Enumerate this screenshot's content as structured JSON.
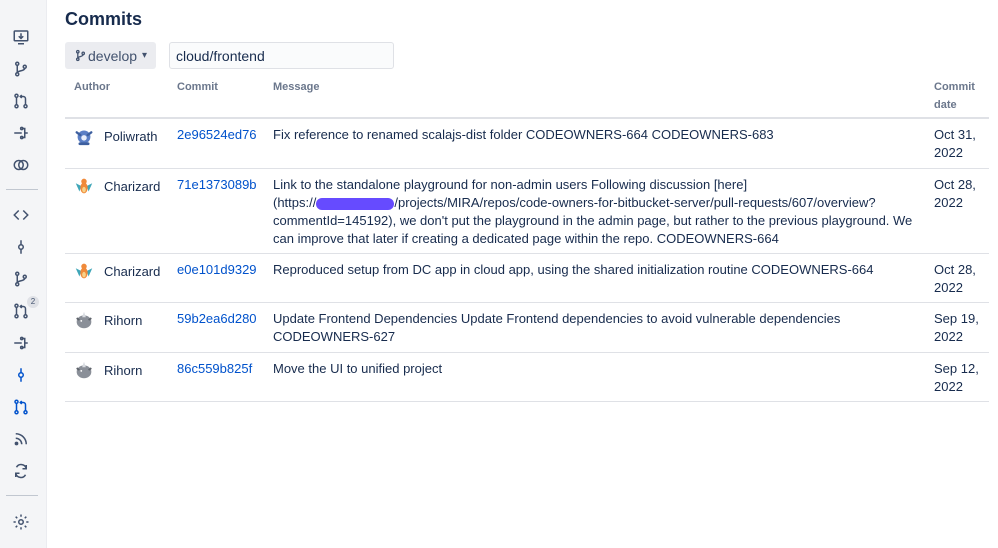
{
  "sidebar": {
    "icons": [
      "clone-icon",
      "create-branch-icon",
      "create-pull-request-icon",
      "fork-icon",
      "compare-icon",
      "source-icon",
      "commits-icon",
      "branches-icon",
      "pull-requests-icon",
      "forks-icon",
      "commits-active-icon",
      "pull-requests-active-icon",
      "feed-icon",
      "sync-icon",
      "settings-icon"
    ],
    "pull_requests_badge": "2"
  },
  "page": {
    "title": "Commits",
    "branch": "develop",
    "repo_filter_value": "cloud/frontend"
  },
  "table": {
    "headers": {
      "author": "Author",
      "commit": "Commit",
      "message": "Message",
      "date_line1": "Commit",
      "date_line2": "date"
    },
    "rows": [
      {
        "author": "Poliwrath",
        "hash": "2e96524ed76",
        "message": "Fix reference to renamed scalajs-dist folder CODEOWNERS-664 CODEOWNERS-683",
        "date_line1": "Oct 31,",
        "date_line2": "2022"
      },
      {
        "author": "Charizard",
        "hash": "71e1373089b",
        "message_lines": [
          "Link to the standalone playground for non-admin users Following discussion [here]",
          "(https://",
          "/projects/MIRA/repos/code-owners-for-bitbucket-server/pull-requests/607/overview?",
          "commentId=145192), we don't put the playground in the admin page, but rather to the previous playground. We",
          "can improve that later if creating a dedicated page within the repo. CODEOWNERS-664"
        ],
        "date_line1": "Oct 28,",
        "date_line2": "2022"
      },
      {
        "author": "Charizard",
        "hash": "e0e101d9329",
        "message": "Reproduced setup from DC app in cloud app, using the shared initialization routine CODEOWNERS-664",
        "date_line1": "Oct 28,",
        "date_line2": "2022"
      },
      {
        "author": "Rihorn",
        "hash": "59b2ea6d280",
        "message_lines": [
          "Update Frontend Dependencies Update Frontend dependencies to avoid vulnerable dependencies",
          "CODEOWNERS-627"
        ],
        "date_line1": "Sep 19,",
        "date_line2": "2022"
      },
      {
        "author": "Rihorn",
        "hash": "86c559b825f",
        "message": "Move the UI to unified project",
        "date_line1": "Sep 12,",
        "date_line2": "2022"
      }
    ]
  },
  "colors": {
    "link": "#0052cc",
    "nav_icon": "#42526e",
    "nav_active": "#0052cc",
    "redaction": "#4b2bff"
  }
}
